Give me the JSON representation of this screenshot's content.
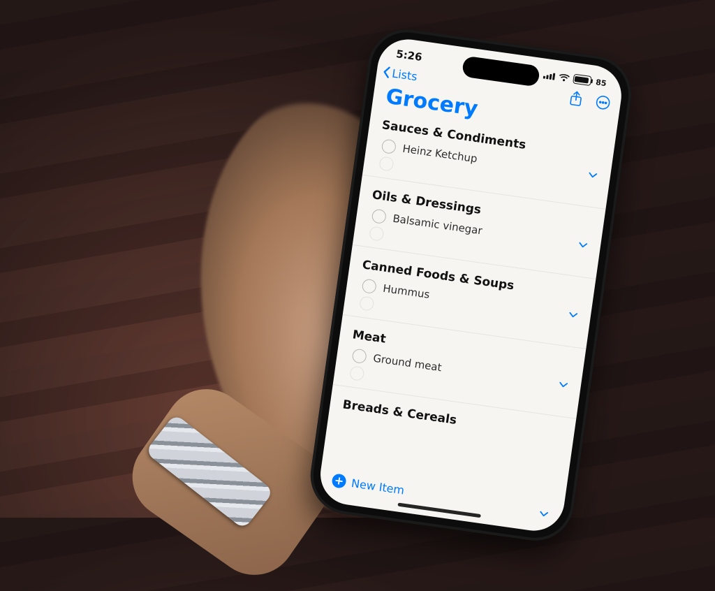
{
  "statusbar": {
    "time": "5:26",
    "battery_percent": "85"
  },
  "nav": {
    "back_label": "Lists"
  },
  "title": "Grocery",
  "sections": [
    {
      "header": "Sauces & Condiments",
      "item": "Heinz Ketchup"
    },
    {
      "header": "Oils & Dressings",
      "item": "Balsamic vinegar"
    },
    {
      "header": "Canned Foods & Soups",
      "item": "Hummus"
    },
    {
      "header": "Meat",
      "item": "Ground meat"
    },
    {
      "header": "Breads & Cereals",
      "item": ""
    }
  ],
  "new_item_label": "New Item"
}
